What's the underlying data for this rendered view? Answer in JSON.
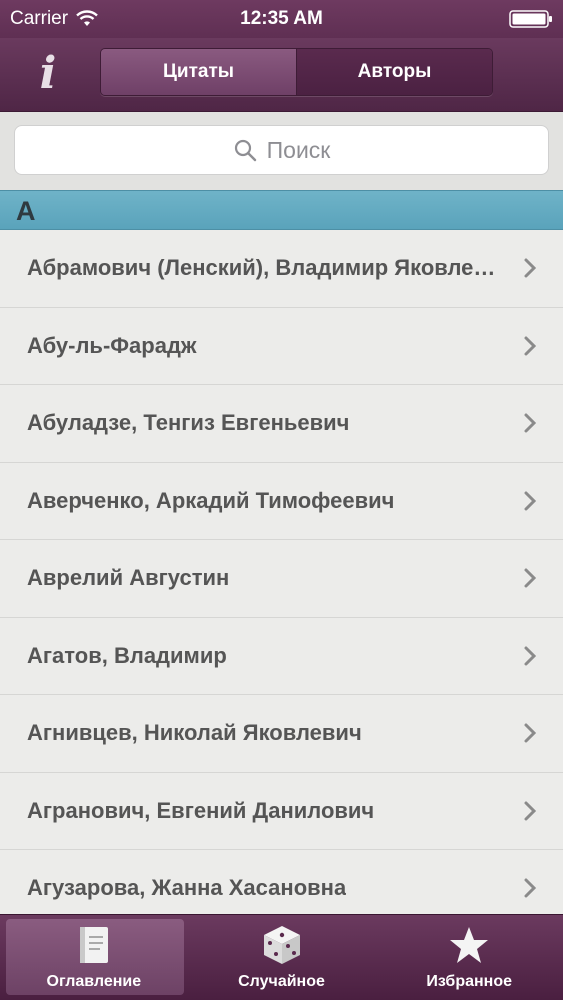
{
  "status_bar": {
    "carrier": "Carrier",
    "time": "12:35 AM"
  },
  "nav": {
    "info_label": "i",
    "segments": [
      {
        "label": "Цитаты",
        "active": true
      },
      {
        "label": "Авторы",
        "active": false
      }
    ]
  },
  "search": {
    "placeholder": "Поиск"
  },
  "section": {
    "letter": "А"
  },
  "authors": [
    "Абрамович (Ленский), Владимир Яковлевич",
    "Абу-ль-Фарадж",
    "Абуладзе, Тенгиз Евгеньевич",
    "Аверченко, Аркадий Тимофеевич",
    "Аврелий Августин",
    "Агатов, Владимир",
    "Агнивцев, Николай Яковлевич",
    "Агранович, Евгений Данилович",
    "Агузарова, Жанна Хасановна"
  ],
  "tabs": [
    {
      "label": "Оглавление",
      "icon": "book-icon",
      "active": true
    },
    {
      "label": "Случайное",
      "icon": "dice-icon",
      "active": false
    },
    {
      "label": "Избранное",
      "icon": "star-icon",
      "active": false
    }
  ],
  "colors": {
    "nav_bg": "#5f2f53",
    "section_bg": "#6fb3c8",
    "list_bg": "#ececea",
    "row_text": "#555555"
  }
}
